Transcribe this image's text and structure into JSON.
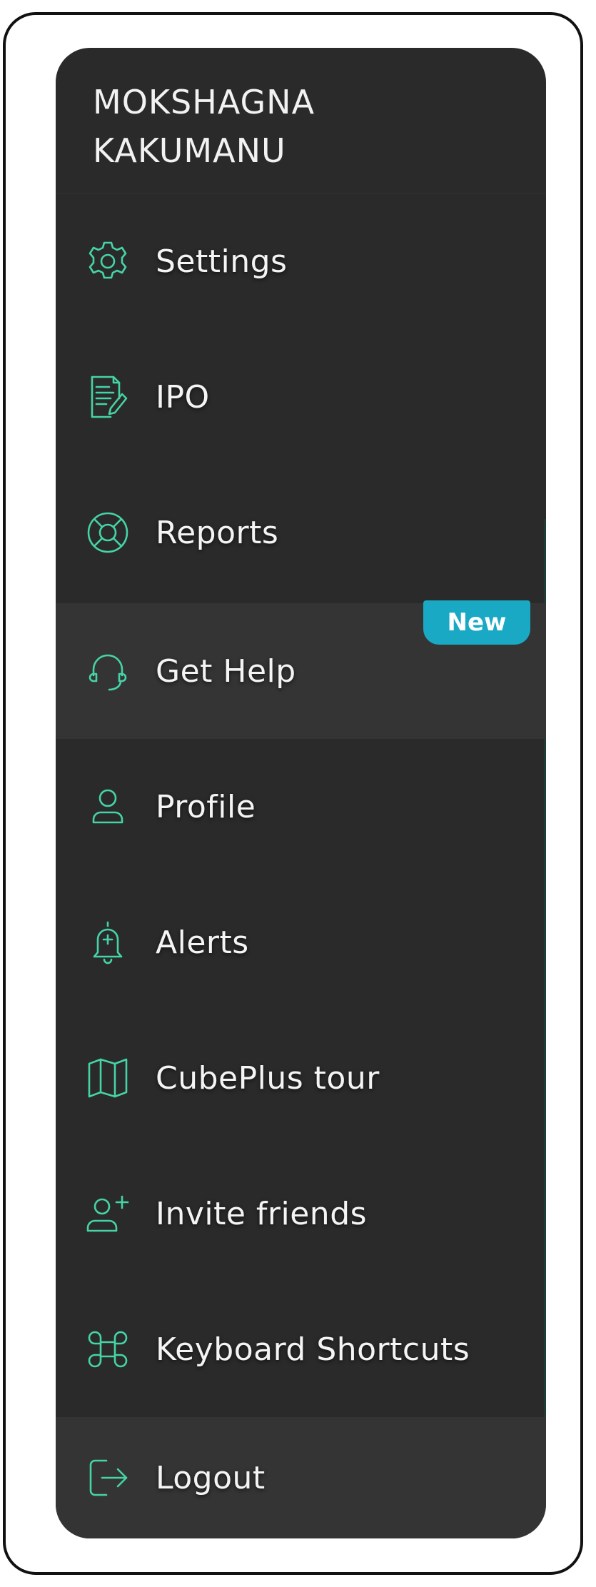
{
  "user": {
    "first_name": "MOKSHAGNA",
    "last_name": "KAKUMANU"
  },
  "menu": {
    "items": [
      {
        "label": "Settings",
        "icon": "gear-icon"
      },
      {
        "label": "IPO",
        "icon": "document-pen-icon"
      },
      {
        "label": "Reports",
        "icon": "lifebuoy-icon"
      },
      {
        "label": "Get Help",
        "icon": "headset-icon",
        "badge": "New",
        "highlighted": true
      },
      {
        "label": "Profile",
        "icon": "user-icon"
      },
      {
        "label": "Alerts",
        "icon": "bell-icon"
      },
      {
        "label": "CubePlus tour",
        "icon": "map-icon"
      },
      {
        "label": "Invite friends",
        "icon": "user-plus-icon"
      },
      {
        "label": "Keyboard Shortcuts",
        "icon": "command-key-icon"
      },
      {
        "label": "Logout",
        "icon": "logout-icon"
      }
    ]
  },
  "colors": {
    "panel_background": "#2a2a2a",
    "highlight_background": "#343434",
    "icon_accent": "#45d4a6",
    "badge_background": "#19a9c4",
    "text": "#f4f4f4"
  }
}
